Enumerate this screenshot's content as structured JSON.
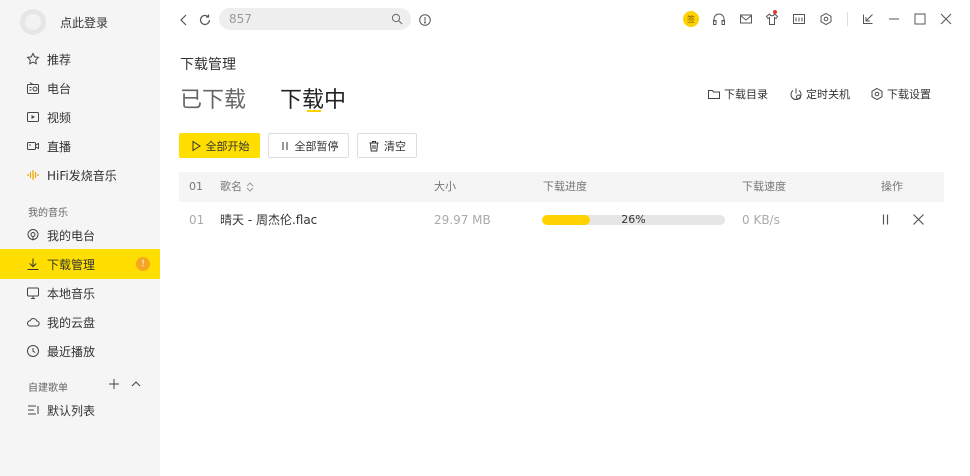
{
  "sidebar": {
    "login_label": "点此登录",
    "items": [
      {
        "label": "推荐",
        "icon": "star-icon"
      },
      {
        "label": "电台",
        "icon": "radio-icon"
      },
      {
        "label": "视频",
        "icon": "video-icon"
      },
      {
        "label": "直播",
        "icon": "live-camera-icon"
      },
      {
        "label": "HiFi发烧音乐",
        "icon": "hifi-waveform-icon"
      }
    ],
    "my_music_title": "我的音乐",
    "my_music": [
      {
        "label": "我的电台",
        "icon": "podcast-icon"
      },
      {
        "label": "下载管理",
        "icon": "download-icon",
        "badge": "!"
      },
      {
        "label": "本地音乐",
        "icon": "monitor-icon"
      },
      {
        "label": "我的云盘",
        "icon": "cloud-icon"
      },
      {
        "label": "最近播放",
        "icon": "clock-icon"
      }
    ],
    "playlists_title": "自建歌单",
    "playlists": [
      {
        "label": "默认列表",
        "icon": "list-icon"
      }
    ]
  },
  "topbar": {
    "search_value": "857",
    "vip_label": "签"
  },
  "main": {
    "breadcrumb": "下载管理",
    "tabs": [
      {
        "label": "已下载"
      },
      {
        "label": "下载中"
      }
    ],
    "actions": {
      "download_dir": "下载目录",
      "timer_shutdown": "定时关机",
      "download_settings": "下载设置"
    },
    "buttons": {
      "start_all": "全部开始",
      "pause_all": "全部暂停",
      "clear": "清空"
    },
    "table": {
      "headers": {
        "index": "01",
        "song": "歌名",
        "size": "大小",
        "progress": "下载进度",
        "speed": "下载速度",
        "actions": "操作"
      },
      "rows": [
        {
          "index": "01",
          "song": "晴天 - 周杰伦.flac",
          "size": "29.97 MB",
          "progress_text": "26%",
          "progress": 0.26,
          "speed": "0 KB/s"
        }
      ]
    }
  },
  "colors": {
    "accent": "#ffde00",
    "sidebar_bg": "#f5f5f5",
    "badge": "#f5a623"
  }
}
